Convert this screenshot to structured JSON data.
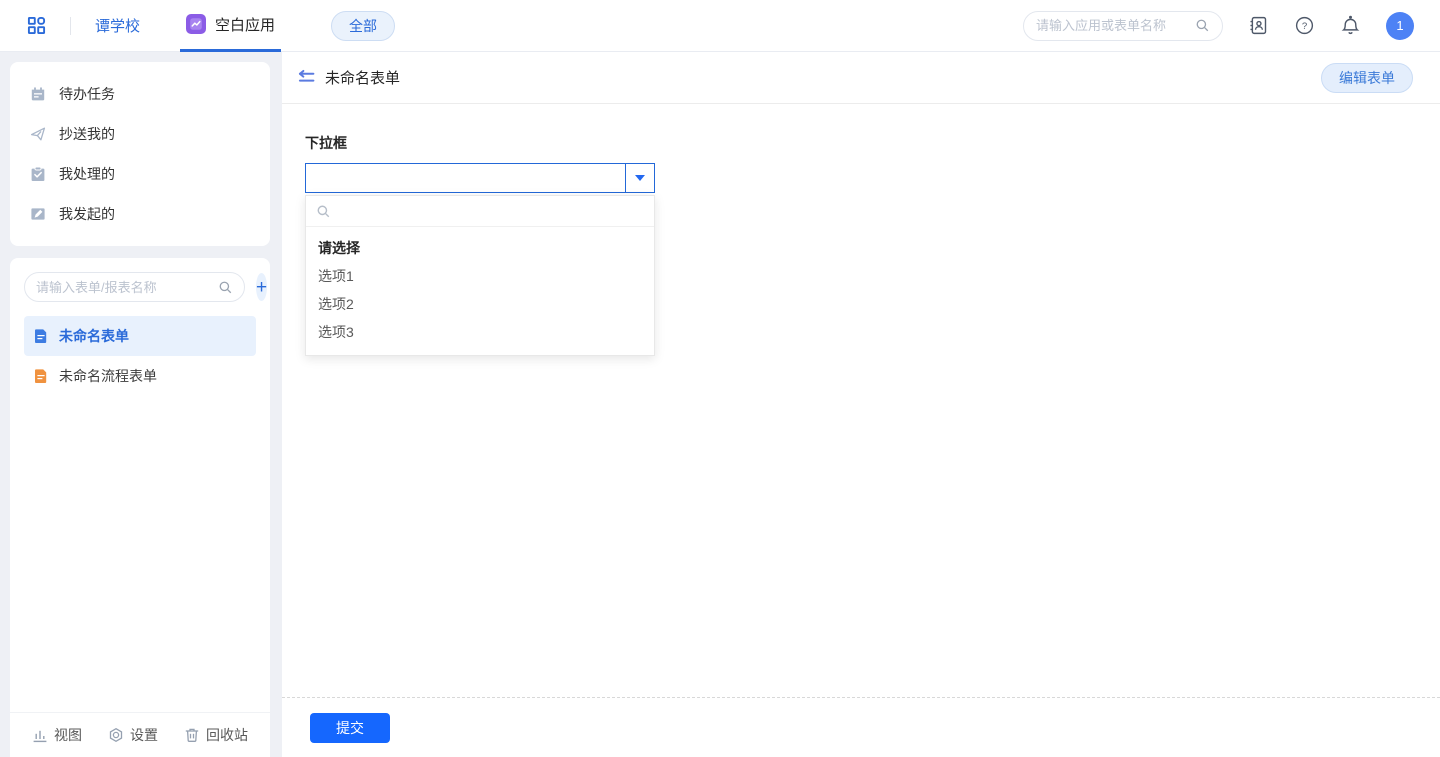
{
  "topbar": {
    "workspace": "谭学校",
    "app_tab": "空白应用",
    "filter_pill": "全部",
    "search_placeholder": "请输入应用或表单名称",
    "avatar_text": "1"
  },
  "sidebar": {
    "menu": [
      {
        "label": "待办任务",
        "icon": "calendar-icon"
      },
      {
        "label": "抄送我的",
        "icon": "send-icon"
      },
      {
        "label": "我处理的",
        "icon": "clipboard-check-icon"
      },
      {
        "label": "我发起的",
        "icon": "edit-doc-icon"
      }
    ],
    "search_placeholder": "请输入表单/报表名称",
    "add_button": "+",
    "forms": [
      {
        "label": "未命名表单",
        "selected": true,
        "icon_color": "#3d7ce2"
      },
      {
        "label": "未命名流程表单",
        "selected": false,
        "icon_color": "#f0923f"
      }
    ],
    "footer": [
      {
        "label": "视图",
        "icon": "chart-icon"
      },
      {
        "label": "设置",
        "icon": "gear-icon"
      },
      {
        "label": "回收站",
        "icon": "trash-icon"
      }
    ]
  },
  "main": {
    "title": "未命名表单",
    "edit_button": "编辑表单",
    "field": {
      "label": "下拉框",
      "value": "",
      "options": [
        "请选择",
        "选项1",
        "选项2",
        "选项3"
      ]
    },
    "submit_button": "提交"
  },
  "colors": {
    "accent_blue": "#2a6ad9",
    "select_border_blue": "#2368d8",
    "submit_blue": "#1567fe",
    "app_icon_purple": "#8b5ce6",
    "selected_item_bg": "#e8f1fd",
    "sidebar_bg": "#eef0f5",
    "doc_icon_blue": "#3d7ce2",
    "doc_icon_orange": "#f0923f"
  }
}
